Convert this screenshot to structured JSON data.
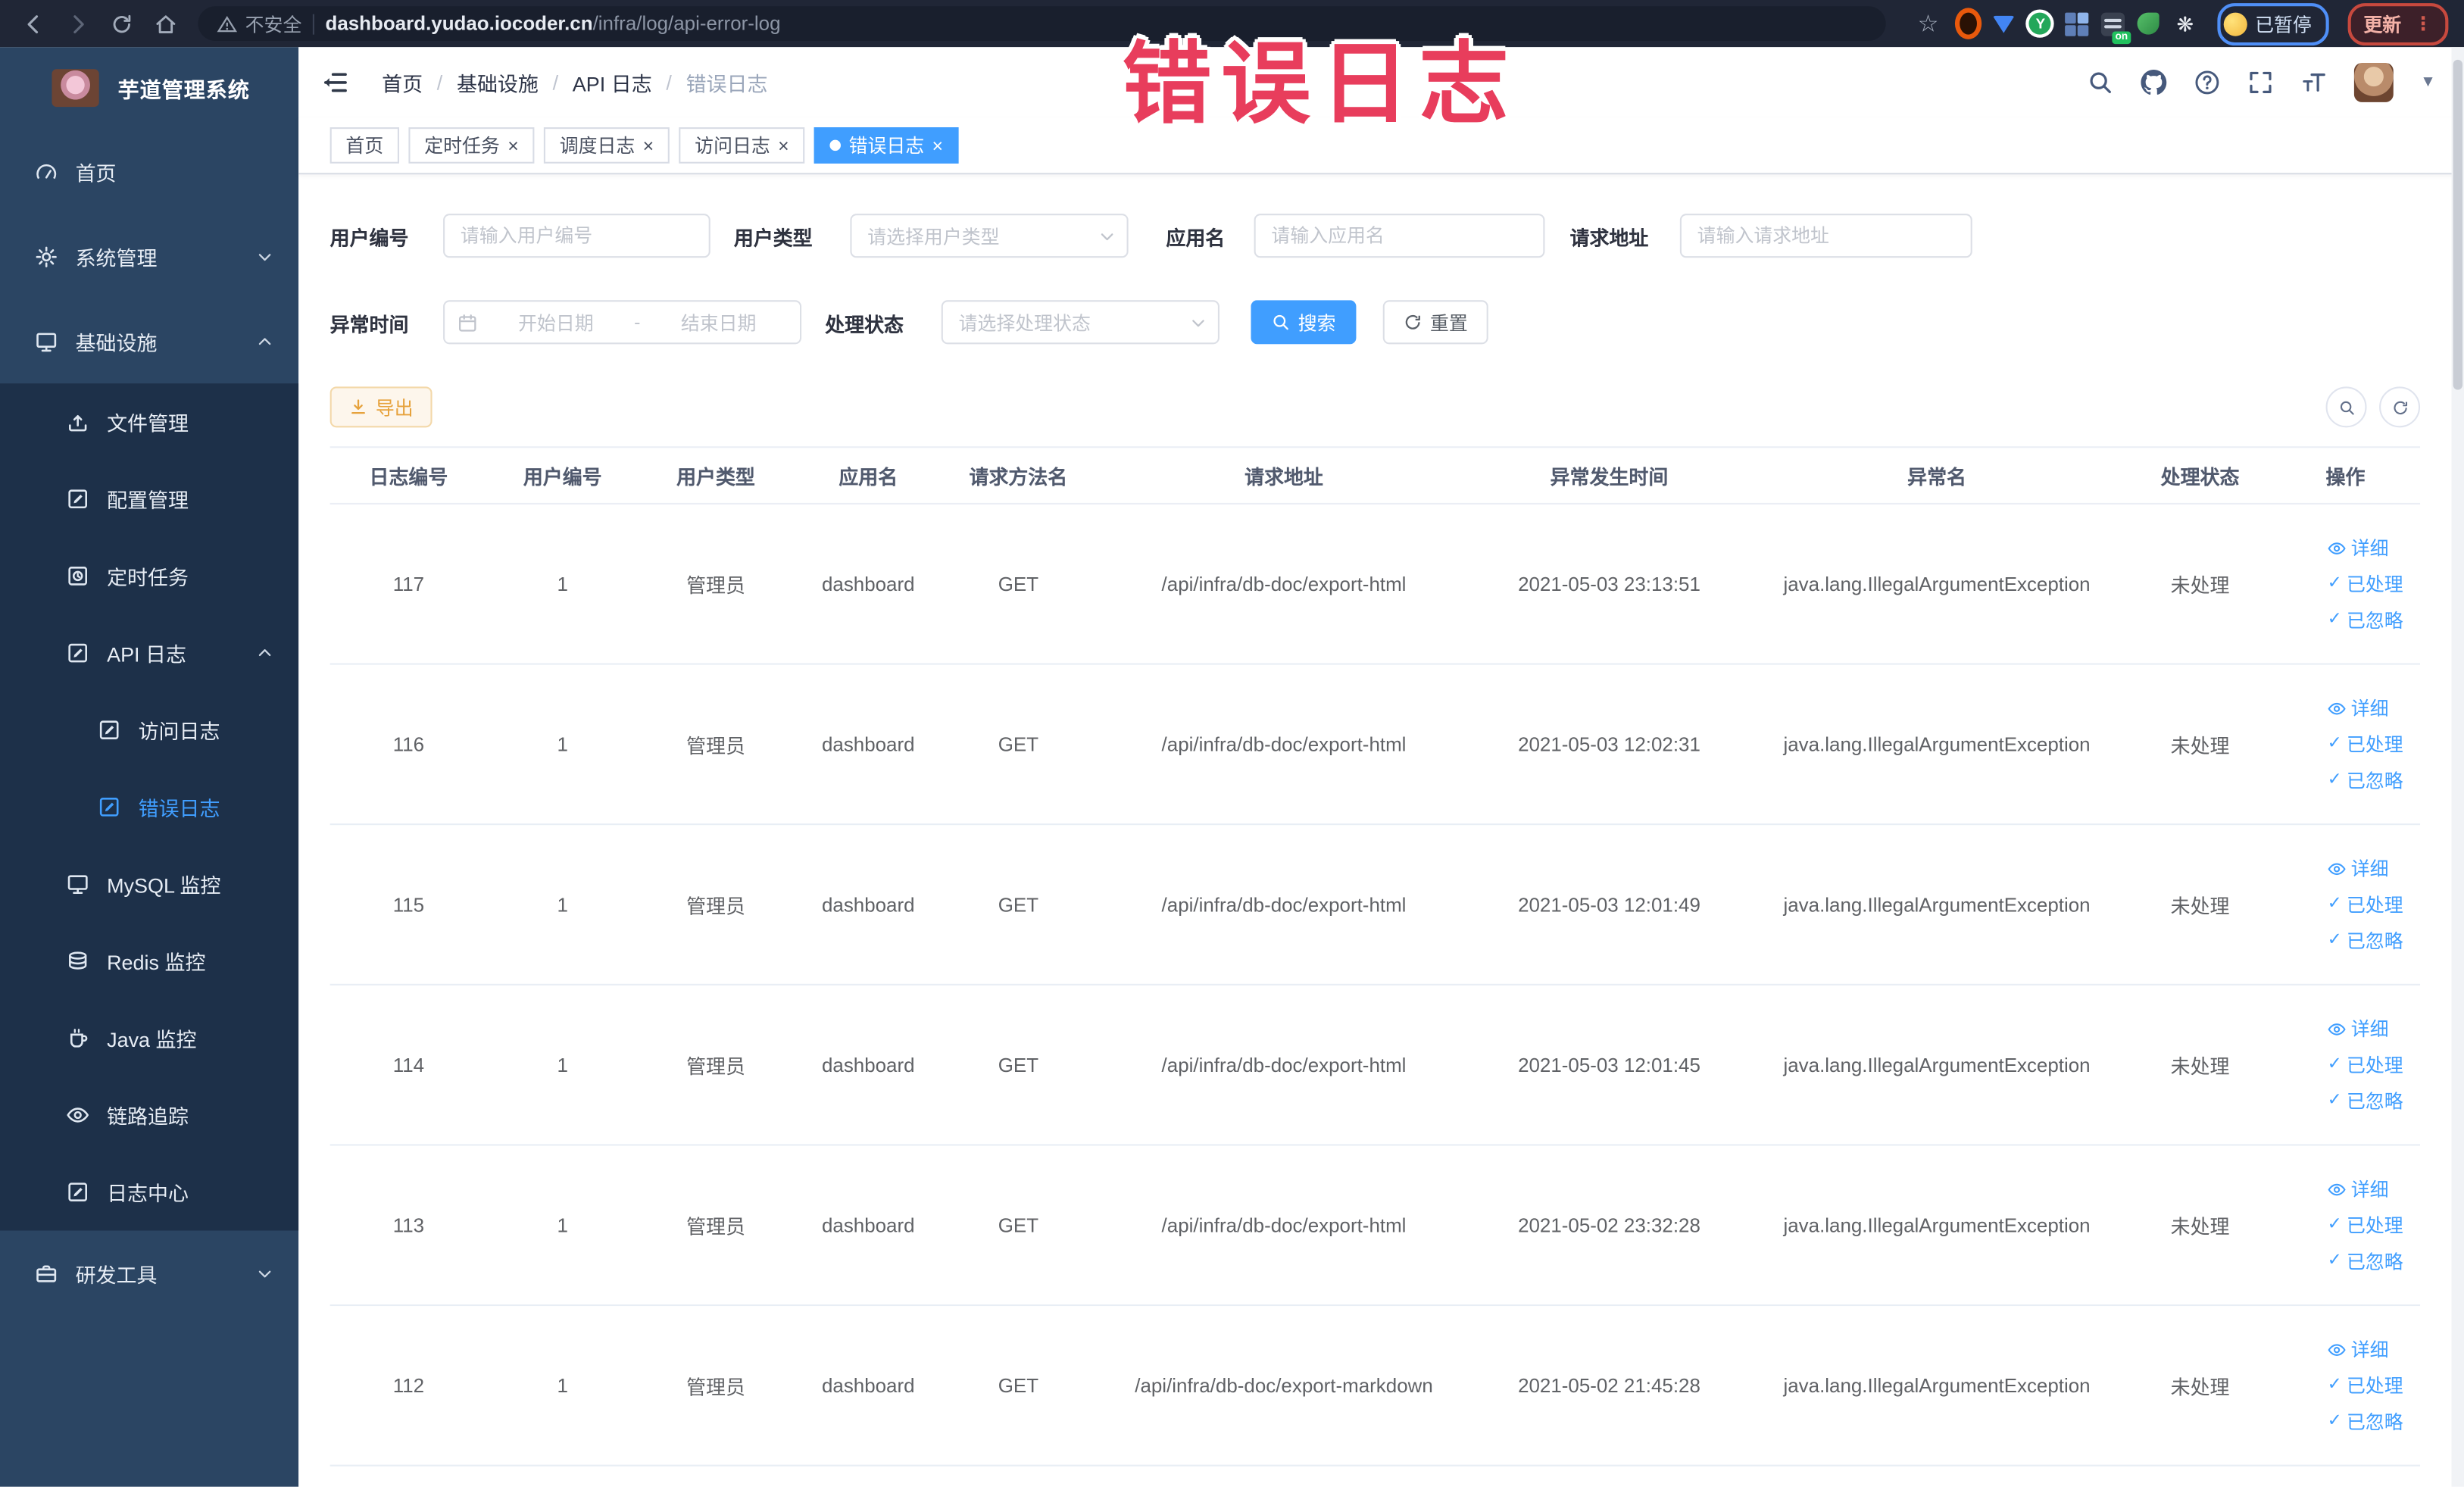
{
  "watermark": {
    "text": "错误日志"
  },
  "browser": {
    "security_label": "不安全",
    "url_host": "dashboard.yudao.iocoder.cn",
    "url_path": "/infra/log/api-error-log",
    "on_badge": "on",
    "profile_chip_label": "已暂停",
    "update_label": "更新"
  },
  "sidebar": {
    "title": "芋道管理系统",
    "items": [
      {
        "label": "首页"
      },
      {
        "label": "系统管理"
      },
      {
        "label": "基础设施"
      },
      {
        "label": "文件管理"
      },
      {
        "label": "配置管理"
      },
      {
        "label": "定时任务"
      },
      {
        "label": "API 日志"
      },
      {
        "label": "访问日志"
      },
      {
        "label": "错误日志"
      },
      {
        "label": "MySQL 监控"
      },
      {
        "label": "Redis 监控"
      },
      {
        "label": "Java 监控"
      },
      {
        "label": "链路追踪"
      },
      {
        "label": "日志中心"
      },
      {
        "label": "研发工具"
      }
    ]
  },
  "app_header": {
    "breadcrumb": {
      "separator": "/",
      "items": [
        "首页",
        "基础设施",
        "API 日志",
        "错误日志"
      ]
    }
  },
  "tabs": [
    {
      "label": "首页"
    },
    {
      "label": "定时任务"
    },
    {
      "label": "调度日志"
    },
    {
      "label": "访问日志"
    },
    {
      "label": "错误日志"
    }
  ],
  "filters": {
    "user_id": {
      "label": "用户编号",
      "placeholder": "请输入用户编号"
    },
    "user_type": {
      "label": "用户类型",
      "placeholder": "请选择用户类型"
    },
    "app_name": {
      "label": "应用名",
      "placeholder": "请输入应用名"
    },
    "request_url": {
      "label": "请求地址",
      "placeholder": "请输入请求地址"
    },
    "exception_time": {
      "label": "异常时间",
      "start_placeholder": "开始日期",
      "separator": "-",
      "end_placeholder": "结束日期"
    },
    "process_status": {
      "label": "处理状态",
      "placeholder": "请选择处理状态"
    },
    "search_label": "搜索",
    "reset_label": "重置"
  },
  "toolbar": {
    "export_label": "导出"
  },
  "table": {
    "columns": [
      "日志编号",
      "用户编号",
      "用户类型",
      "应用名",
      "请求方法名",
      "请求地址",
      "异常发生时间",
      "异常名",
      "处理状态",
      "操作"
    ],
    "ops": {
      "detail": "详细",
      "processed": "已处理",
      "ignored": "已忽略"
    },
    "rows": [
      {
        "id": "117",
        "user_id": "1",
        "user_type": "管理员",
        "app": "dashboard",
        "method": "GET",
        "url": "/api/infra/db-doc/export-html",
        "time": "2021-05-03 23:13:51",
        "exception": "java.lang.IllegalArgumentException",
        "status": "未处理"
      },
      {
        "id": "116",
        "user_id": "1",
        "user_type": "管理员",
        "app": "dashboard",
        "method": "GET",
        "url": "/api/infra/db-doc/export-html",
        "time": "2021-05-03 12:02:31",
        "exception": "java.lang.IllegalArgumentException",
        "status": "未处理"
      },
      {
        "id": "115",
        "user_id": "1",
        "user_type": "管理员",
        "app": "dashboard",
        "method": "GET",
        "url": "/api/infra/db-doc/export-html",
        "time": "2021-05-03 12:01:49",
        "exception": "java.lang.IllegalArgumentException",
        "status": "未处理"
      },
      {
        "id": "114",
        "user_id": "1",
        "user_type": "管理员",
        "app": "dashboard",
        "method": "GET",
        "url": "/api/infra/db-doc/export-html",
        "time": "2021-05-03 12:01:45",
        "exception": "java.lang.IllegalArgumentException",
        "status": "未处理"
      },
      {
        "id": "113",
        "user_id": "1",
        "user_type": "管理员",
        "app": "dashboard",
        "method": "GET",
        "url": "/api/infra/db-doc/export-html",
        "time": "2021-05-02 23:32:28",
        "exception": "java.lang.IllegalArgumentException",
        "status": "未处理"
      },
      {
        "id": "112",
        "user_id": "1",
        "user_type": "管理员",
        "app": "dashboard",
        "method": "GET",
        "url": "/api/infra/db-doc/export-markdown",
        "time": "2021-05-02 21:45:28",
        "exception": "java.lang.IllegalArgumentException",
        "status": "未处理"
      }
    ]
  }
}
